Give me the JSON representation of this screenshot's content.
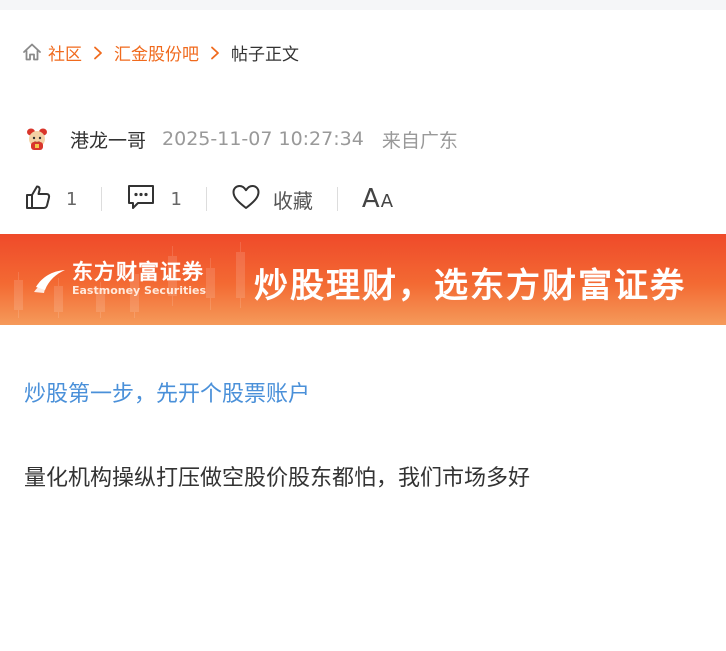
{
  "breadcrumb": {
    "items": [
      "社区",
      "汇金股份吧"
    ],
    "current": "帖子正文"
  },
  "post": {
    "author": "港龙一哥",
    "time": "2025-11-07 10:27:34",
    "location": "来自广东",
    "content": "量化机构操纵打压做空股价股东都怕，我们市场多好"
  },
  "actions": {
    "like_count": "1",
    "comment_count": "1",
    "favorite_label": "收藏",
    "font_big": "A",
    "font_small": "A"
  },
  "banner": {
    "brand_cn": "东方财富证券",
    "brand_en": "Eastmoney Securities",
    "slogan": "炒股理财，选东方财富证券"
  },
  "promo": {
    "link_text": "炒股第一步，先开个股票账户"
  },
  "colors": {
    "accent": "#f06a1d",
    "link_blue": "#4a90d9",
    "banner_red": "#ef4a2a",
    "muted_text": "#999999"
  }
}
